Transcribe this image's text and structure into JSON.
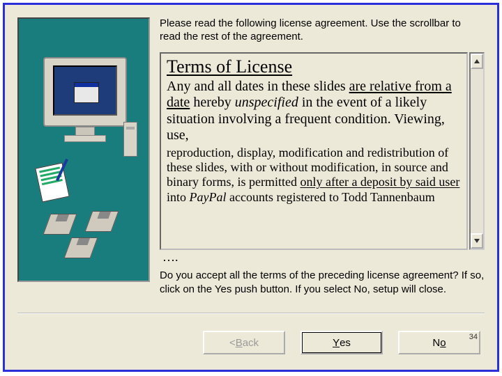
{
  "instructions": "Please read the following license agreement. Use the scrollbar to read the rest of the agreement.",
  "license": {
    "title": "Terms of License",
    "body_main_pre": "Any and all dates in these slides ",
    "body_main_u1": "are relative from a date",
    "body_main_mid": " hereby ",
    "body_main_ital": "unspecified",
    "body_main_post": " in the event of a likely situation involving a frequent condition. Viewing, use,",
    "body_cont_pre": "reproduction, display, modification and redistribution of these slides, with or without modification, in source and binary forms, is permitted ",
    "body_cont_u": "only after a deposit by said user",
    "body_cont_post_pre": " into ",
    "body_cont_post_ital": "PayPal",
    "body_cont_post_end": " accounts registered to Todd Tannenbaum",
    "ellipsis": "…."
  },
  "accept_question": "Do you accept all the terms of the preceding license agreement? If so, click on the Yes push button. If you select No, setup will close.",
  "buttons": {
    "back_prefix": "< ",
    "back_mnemonic": "B",
    "back_rest": "ack",
    "yes_mnemonic": "Y",
    "yes_rest": "es",
    "no_mnemonic": "o",
    "no_prefix": "N"
  },
  "page_number": "34"
}
